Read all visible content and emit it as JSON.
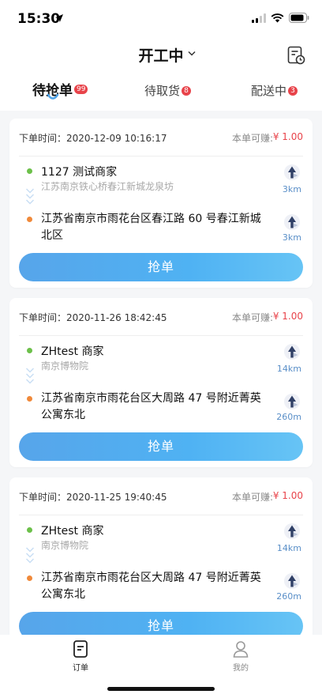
{
  "status_bar": {
    "time": "15:30"
  },
  "header": {
    "title": "开工中",
    "tabs": [
      {
        "label": "待抢单",
        "badge": "99"
      },
      {
        "label": "待取货",
        "badge": "8"
      },
      {
        "label": "配送中",
        "badge": "3"
      }
    ]
  },
  "orders": [
    {
      "time_label": "下单时间：",
      "time": "2020-12-09 10:16:17",
      "earn_label": "本单可赚:",
      "earn": "¥ 1.00",
      "pickup_name": "1127 测试商家",
      "pickup_address": "江苏南京铁心桥春江新城龙泉坊",
      "pickup_distance": "3km",
      "dropoff_address": "江苏省南京市雨花台区春江路 60 号春江新城北区",
      "dropoff_distance": "3km",
      "button_label": "抢单"
    },
    {
      "time_label": "下单时间：",
      "time": "2020-11-26 18:42:45",
      "earn_label": "本单可赚:",
      "earn": "¥ 1.00",
      "pickup_name": "ZHtest 商家",
      "pickup_address": "南京博物院",
      "pickup_distance": "14km",
      "dropoff_address": "江苏省南京市雨花台区大周路 47 号附近菁英公寓东北",
      "dropoff_distance": "260m",
      "button_label": "抢单"
    },
    {
      "time_label": "下单时间：",
      "time": "2020-11-25 19:40:45",
      "earn_label": "本单可赚:",
      "earn": "¥ 1.00",
      "pickup_name": "ZHtest 商家",
      "pickup_address": "南京博物院",
      "pickup_distance": "14km",
      "dropoff_address": "江苏省南京市雨花台区大周路 47 号附近菁英公寓东北",
      "dropoff_distance": "260m",
      "button_label": "抢单"
    }
  ],
  "tabbar": [
    {
      "label": "订单",
      "icon": "order-icon"
    },
    {
      "label": "我的",
      "icon": "profile-icon"
    }
  ],
  "colors": {
    "accent": "#4fb2f3",
    "badge": "#e8434a",
    "earn": "#e8434a",
    "distance": "#5a8fc8",
    "pickup_dot": "#6cc04a",
    "dropoff_dot": "#f0893a"
  }
}
